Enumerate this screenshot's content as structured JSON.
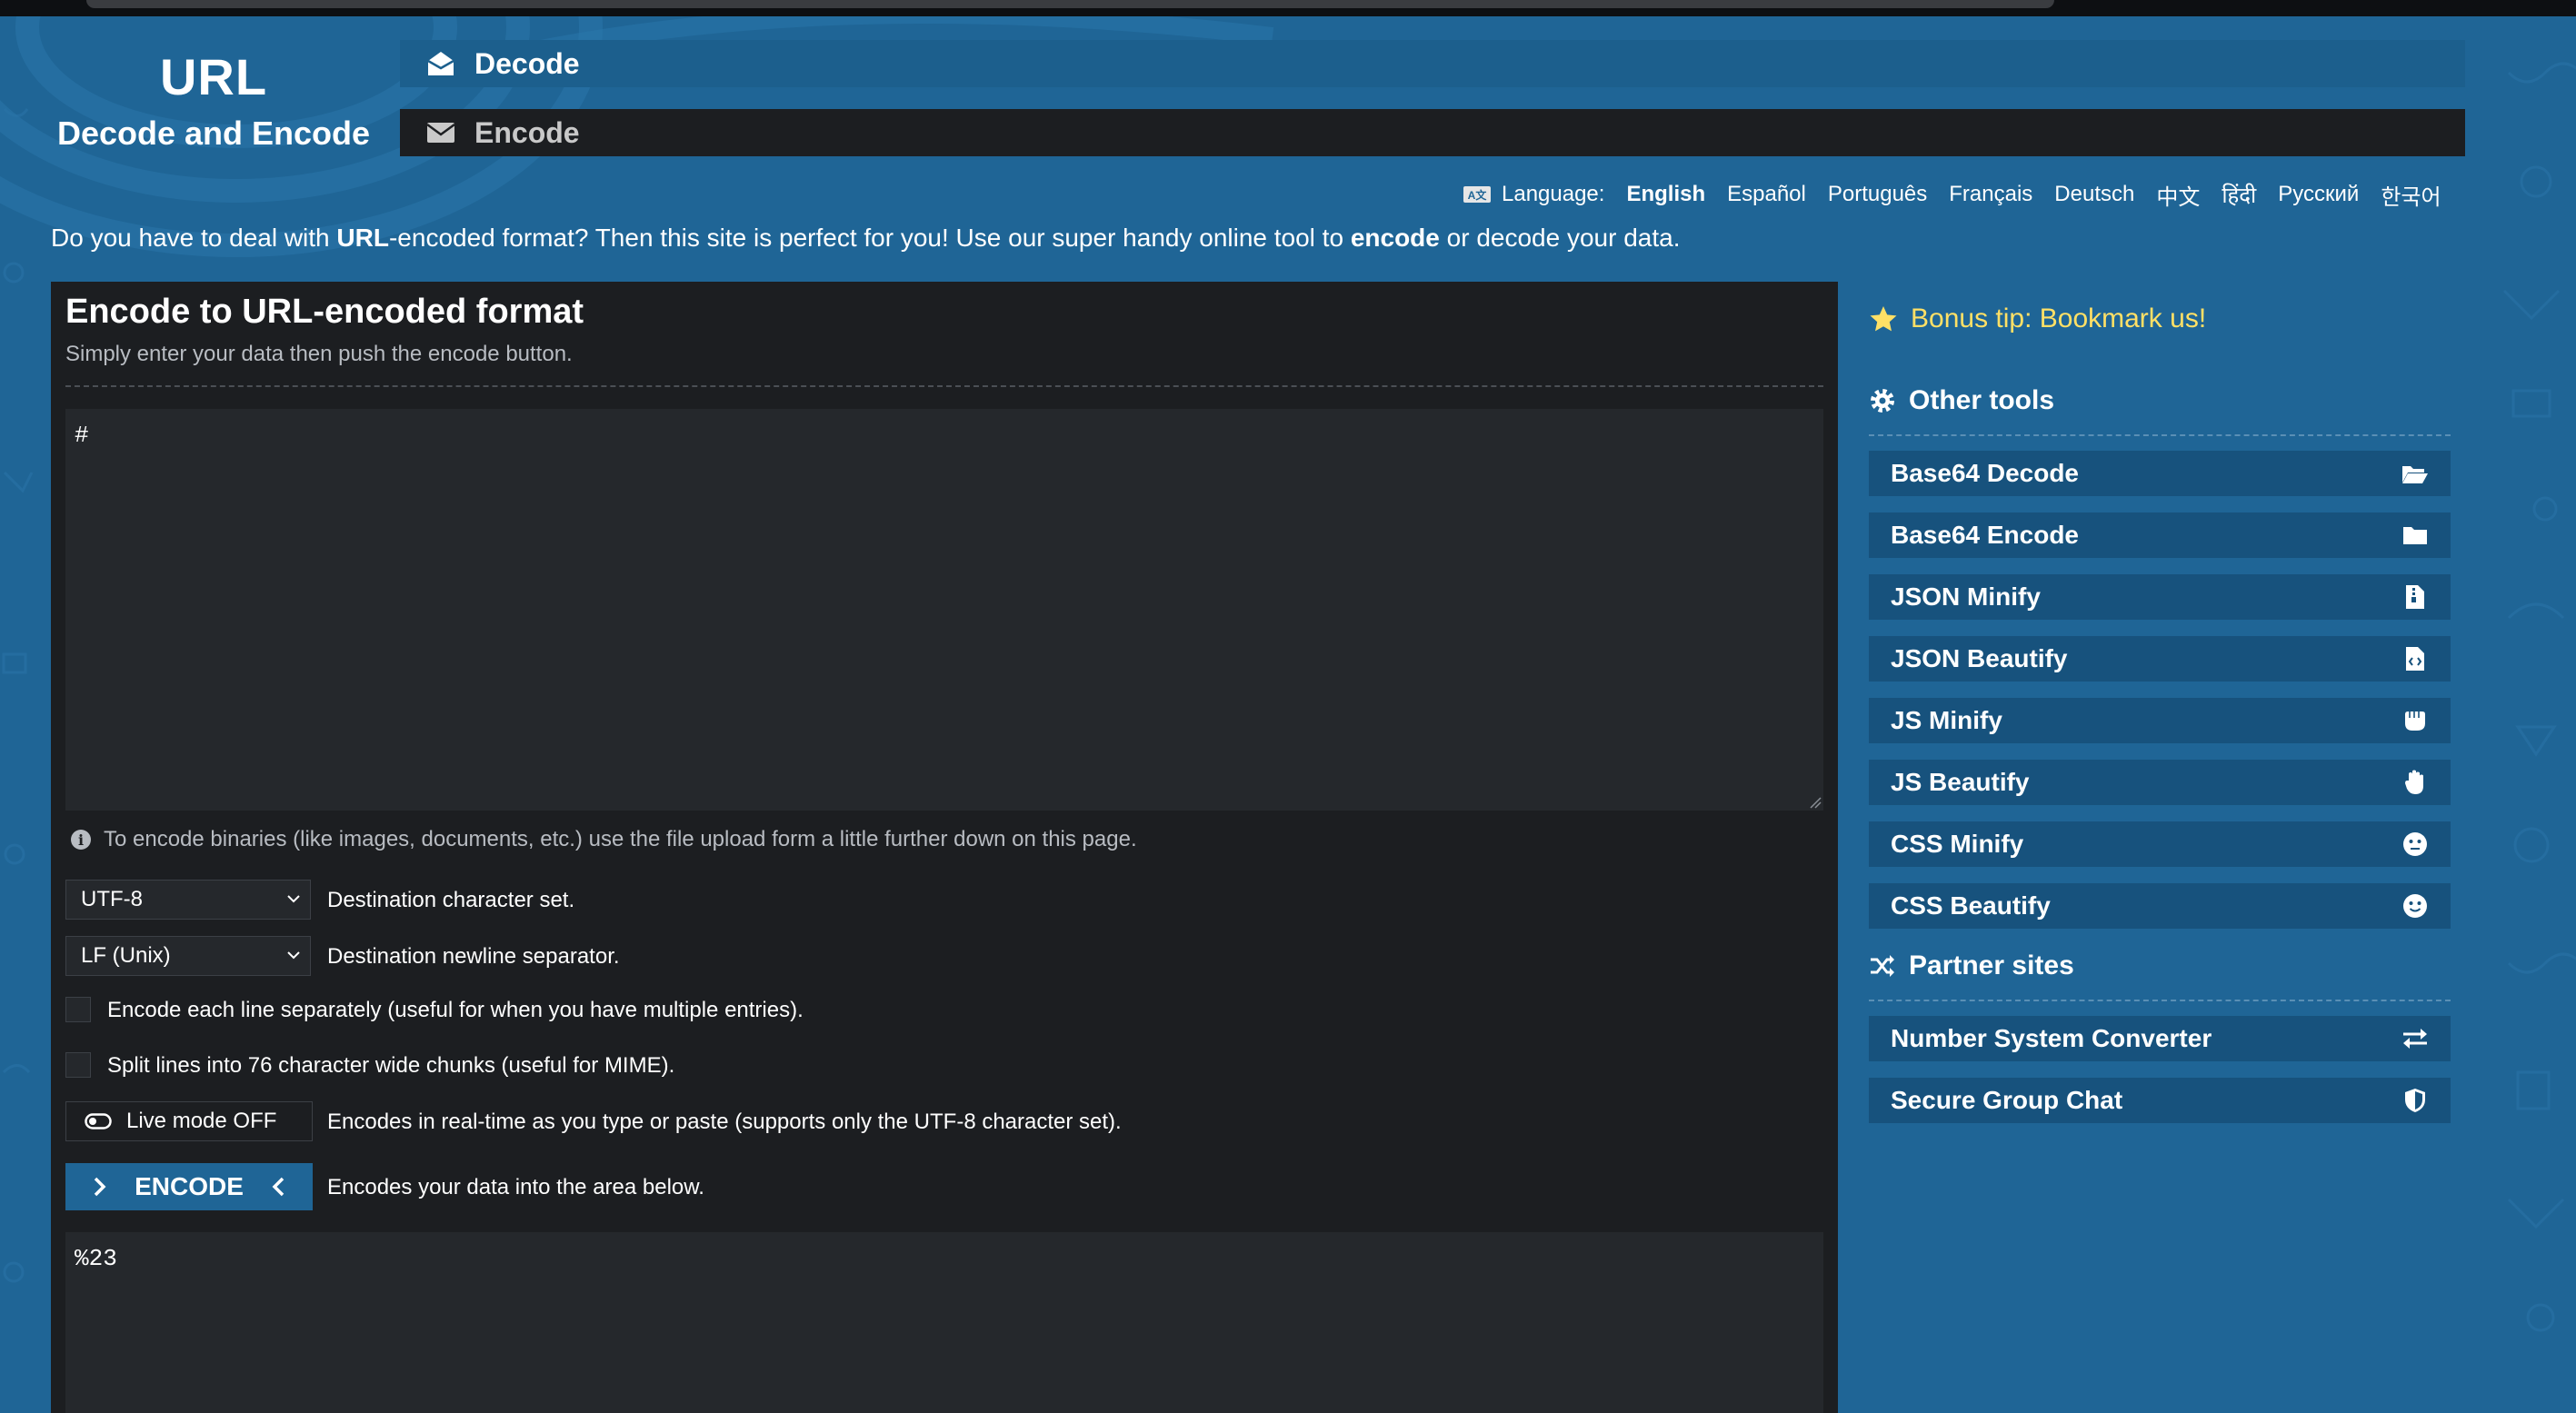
{
  "header": {
    "logo_title": "URL",
    "logo_subtitle": "Decode and Encode"
  },
  "tabs": [
    {
      "label": "Decode",
      "icon": "envelope-open-icon",
      "active": false
    },
    {
      "label": "Encode",
      "icon": "envelope-icon",
      "active": true
    }
  ],
  "language": {
    "prefix": "Language:",
    "options": [
      "English",
      "Español",
      "Português",
      "Français",
      "Deutsch",
      "中文",
      "हिंदी",
      "Русский",
      "한국어"
    ],
    "selected": "English"
  },
  "intro": {
    "part1": "Do you have to deal with ",
    "bold1": "URL",
    "part2": "-encoded format? Then this site is perfect for you! Use our super handy online tool to ",
    "bold2": "encode",
    "part3": " or decode your data."
  },
  "panel": {
    "title": "Encode to URL-encoded format",
    "subtitle": "Simply enter your data then push the encode button.",
    "input_value": "#",
    "binary_note": "To encode binaries (like images, documents, etc.) use the file upload form a little further down on this page.",
    "charset": {
      "value": "UTF-8",
      "label": "Destination character set."
    },
    "newline": {
      "value": "LF (Unix)",
      "label": "Destination newline separator."
    },
    "encode_each_line": {
      "checked": false,
      "label": "Encode each line separately (useful for when you have multiple entries)."
    },
    "split_lines": {
      "checked": false,
      "label": "Split lines into 76 character wide chunks (useful for MIME)."
    },
    "live_mode": {
      "label": "Live mode OFF",
      "description": "Encodes in real-time as you type or paste (supports only the UTF-8 character set)."
    },
    "encode_button": {
      "label": "ENCODE",
      "description": "Encodes your data into the area below."
    },
    "output_value": "%23"
  },
  "sidebar": {
    "bonus_tip": "Bonus tip: Bookmark us!",
    "other_tools_heading": "Other tools",
    "tools": [
      {
        "label": "Base64 Decode",
        "icon": "folder-open-icon"
      },
      {
        "label": "Base64 Encode",
        "icon": "folder-icon"
      },
      {
        "label": "JSON Minify",
        "icon": "file-zipper-icon"
      },
      {
        "label": "JSON Beautify",
        "icon": "file-code-icon"
      },
      {
        "label": "JS Minify",
        "icon": "hand-fist-icon"
      },
      {
        "label": "JS Beautify",
        "icon": "hand-icon"
      },
      {
        "label": "CSS Minify",
        "icon": "face-meh-icon"
      },
      {
        "label": "CSS Beautify",
        "icon": "face-smile-icon"
      }
    ],
    "partner_heading": "Partner sites",
    "partners": [
      {
        "label": "Number System Converter",
        "icon": "arrows-exchange-icon"
      },
      {
        "label": "Secure Group Chat",
        "icon": "shield-icon"
      }
    ]
  },
  "colors": {
    "background": "#1f6596",
    "panel": "#1c1e21",
    "textarea": "#25282c",
    "sidebar_item": "#17527d",
    "bonus": "#ffe066"
  }
}
